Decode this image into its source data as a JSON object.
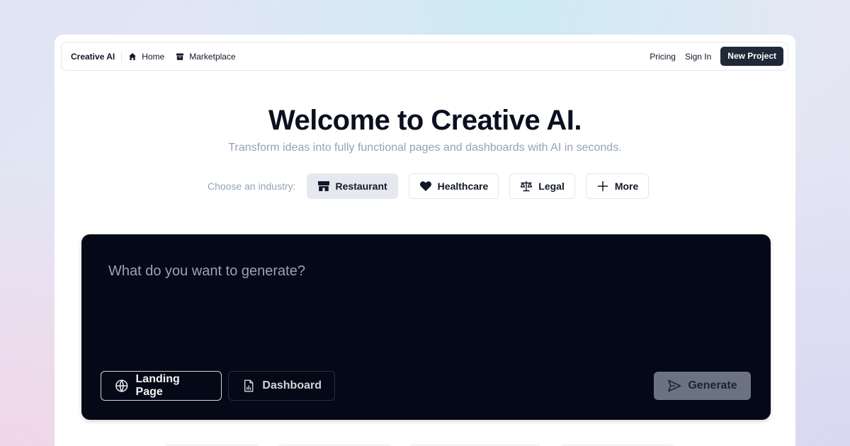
{
  "navbar": {
    "brand": "Creative AI",
    "links": [
      {
        "label": "Home",
        "icon": "home-icon"
      },
      {
        "label": "Marketplace",
        "icon": "archive-icon"
      }
    ],
    "pricing": "Pricing",
    "sign_in": "Sign In",
    "new_project": "New Project"
  },
  "hero": {
    "title": "Welcome to Creative AI.",
    "subtitle": "Transform ideas into fully functional pages and dashboards with AI in seconds."
  },
  "industry": {
    "label": "Choose an industry:",
    "options": [
      {
        "label": "Restaurant",
        "icon": "storefront-icon",
        "selected": true
      },
      {
        "label": "Healthcare",
        "icon": "heart-icon",
        "selected": false
      },
      {
        "label": "Legal",
        "icon": "scale-icon",
        "selected": false
      },
      {
        "label": "More",
        "icon": "plus-icon",
        "selected": false
      }
    ]
  },
  "prompt": {
    "placeholder": "What do you want to generate?",
    "modes": [
      {
        "label": "Landing Page",
        "icon": "globe-icon",
        "selected": true
      },
      {
        "label": "Dashboard",
        "icon": "chart-document-icon",
        "selected": false
      }
    ],
    "generate": "Generate"
  },
  "colors": {
    "primary_dark": "#1f2937",
    "prompt_bg": "#050816",
    "muted_text": "#94a3b8",
    "chip_active_bg": "#e5e9ef"
  }
}
